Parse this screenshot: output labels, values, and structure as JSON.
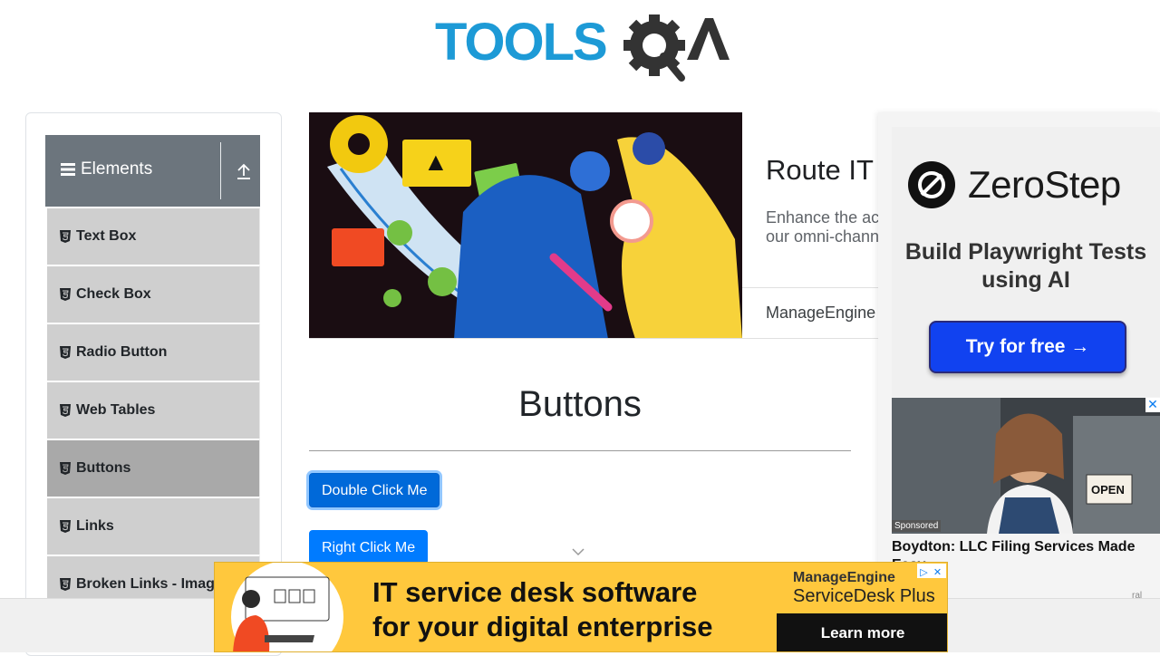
{
  "sidebar": {
    "group_title": "Elements",
    "items": [
      {
        "label": "Text Box"
      },
      {
        "label": "Check Box"
      },
      {
        "label": "Radio Button"
      },
      {
        "label": "Web Tables"
      },
      {
        "label": "Buttons",
        "active": true
      },
      {
        "label": "Links"
      },
      {
        "label": "Broken Links - Images"
      }
    ]
  },
  "top_ad": {
    "headline": "Route IT t",
    "description": "Enhance the ac\nour omni-chann",
    "brand": "ManageEngine"
  },
  "main": {
    "title": "Buttons",
    "double_click_label": "Double Click Me",
    "right_click_label": "Right Click Me"
  },
  "side_ad": {
    "brand": "ZeroStep",
    "tagline": "Build Playwright Tests using AI",
    "cta": "Try for free →",
    "sponsored_badge": "Sponsored",
    "sponsored_title": "Boydton: LLC Filing Services Made Easy",
    "close_symbol": "✕",
    "attribution": "ral"
  },
  "bottom_ad": {
    "line1": "IT service desk software",
    "line2": "for your digital enterprise",
    "brand_top": "ManageEngine",
    "brand_product": "ServiceDesk Plus",
    "cta": "Learn more",
    "adchoice_info": "▷",
    "adchoice_close": "✕"
  },
  "colors": {
    "primary_button": "#007bff",
    "sidebar_header": "#6c757d",
    "menu_item": "#cfcfcf",
    "menu_active": "#a9a9a9",
    "logo_blue": "#1d9ad6"
  }
}
